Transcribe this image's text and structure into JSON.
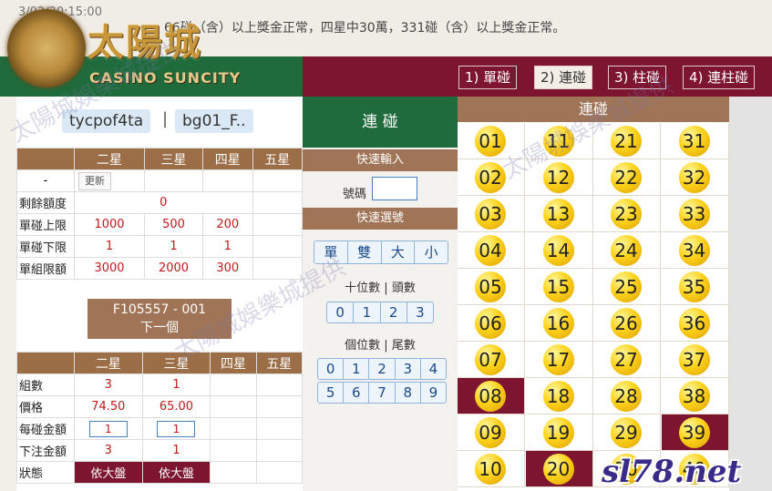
{
  "marquee": {
    "datetime": "3/02/20:15:00",
    "text": "66碰（含）以上獎金正常，四星中30萬，331碰（含）以上獎金正常。"
  },
  "logo": {
    "name": "太陽城",
    "brand": "CASINO SUNCITY"
  },
  "tabs": [
    {
      "label": "1) 單碰",
      "active": false
    },
    {
      "label": "2) 連碰",
      "active": true
    },
    {
      "label": "3) 柱碰",
      "active": false
    },
    {
      "label": "4) 連柱碰",
      "active": false
    }
  ],
  "user": {
    "account": "tycpof4ta",
    "separator": "|",
    "group": "bg01_F.."
  },
  "limits": {
    "headers": [
      "二星",
      "三星",
      "四星",
      "五星"
    ],
    "update_label": "更新",
    "dash": "-",
    "rows": [
      {
        "label": "剩餘額度",
        "values": [
          "0"
        ]
      },
      {
        "label": "單碰上限",
        "values": [
          "1000",
          "500",
          "200",
          ""
        ]
      },
      {
        "label": "單碰下限",
        "values": [
          "1",
          "1",
          "1",
          ""
        ]
      },
      {
        "label": "單組限額",
        "values": [
          "3000",
          "2000",
          "300",
          ""
        ]
      }
    ]
  },
  "next_button": {
    "code": "F105557 - 001",
    "label": "下一個"
  },
  "bet": {
    "headers": [
      "二星",
      "三星",
      "四星",
      "五星"
    ],
    "rows": [
      {
        "label": "組數",
        "values": [
          "3",
          "1",
          "",
          ""
        ]
      },
      {
        "label": "價格",
        "values": [
          "74.50",
          "65.00",
          "",
          ""
        ]
      },
      {
        "label": "每碰金額",
        "inputs": [
          "1",
          "1"
        ]
      },
      {
        "label": "下注金額",
        "values": [
          "3",
          "1",
          "",
          ""
        ]
      },
      {
        "label": "狀態",
        "status": [
          "依大盤",
          "依大盤"
        ]
      }
    ]
  },
  "mid": {
    "title": "連 碰",
    "quick_input": "快速輸入",
    "code_label": "號碼",
    "quick_select": "快速選號",
    "parity": [
      "單",
      "雙",
      "大",
      "小"
    ],
    "tens_label": "十位數 | 頭數",
    "tens": [
      "0",
      "1",
      "2",
      "3"
    ],
    "units_label": "個位數 | 尾數",
    "units": [
      "0",
      "1",
      "2",
      "3",
      "4",
      "5",
      "6",
      "7",
      "8",
      "9"
    ]
  },
  "balls": {
    "title": "連碰",
    "columns": [
      [
        "01",
        "02",
        "03",
        "04",
        "05",
        "06",
        "07",
        "08",
        "09",
        "10"
      ],
      [
        "11",
        "12",
        "13",
        "14",
        "15",
        "16",
        "17",
        "18",
        "19",
        "20"
      ],
      [
        "21",
        "22",
        "23",
        "24",
        "25",
        "26",
        "27",
        "28",
        "29",
        "30"
      ],
      [
        "31",
        "32",
        "33",
        "34",
        "35",
        "36",
        "37",
        "38",
        "39",
        "40"
      ]
    ],
    "selected": [
      "08",
      "20",
      "39"
    ]
  },
  "watermark": {
    "site": "sl78.net",
    "text": "太陽城娛樂城提供"
  }
}
